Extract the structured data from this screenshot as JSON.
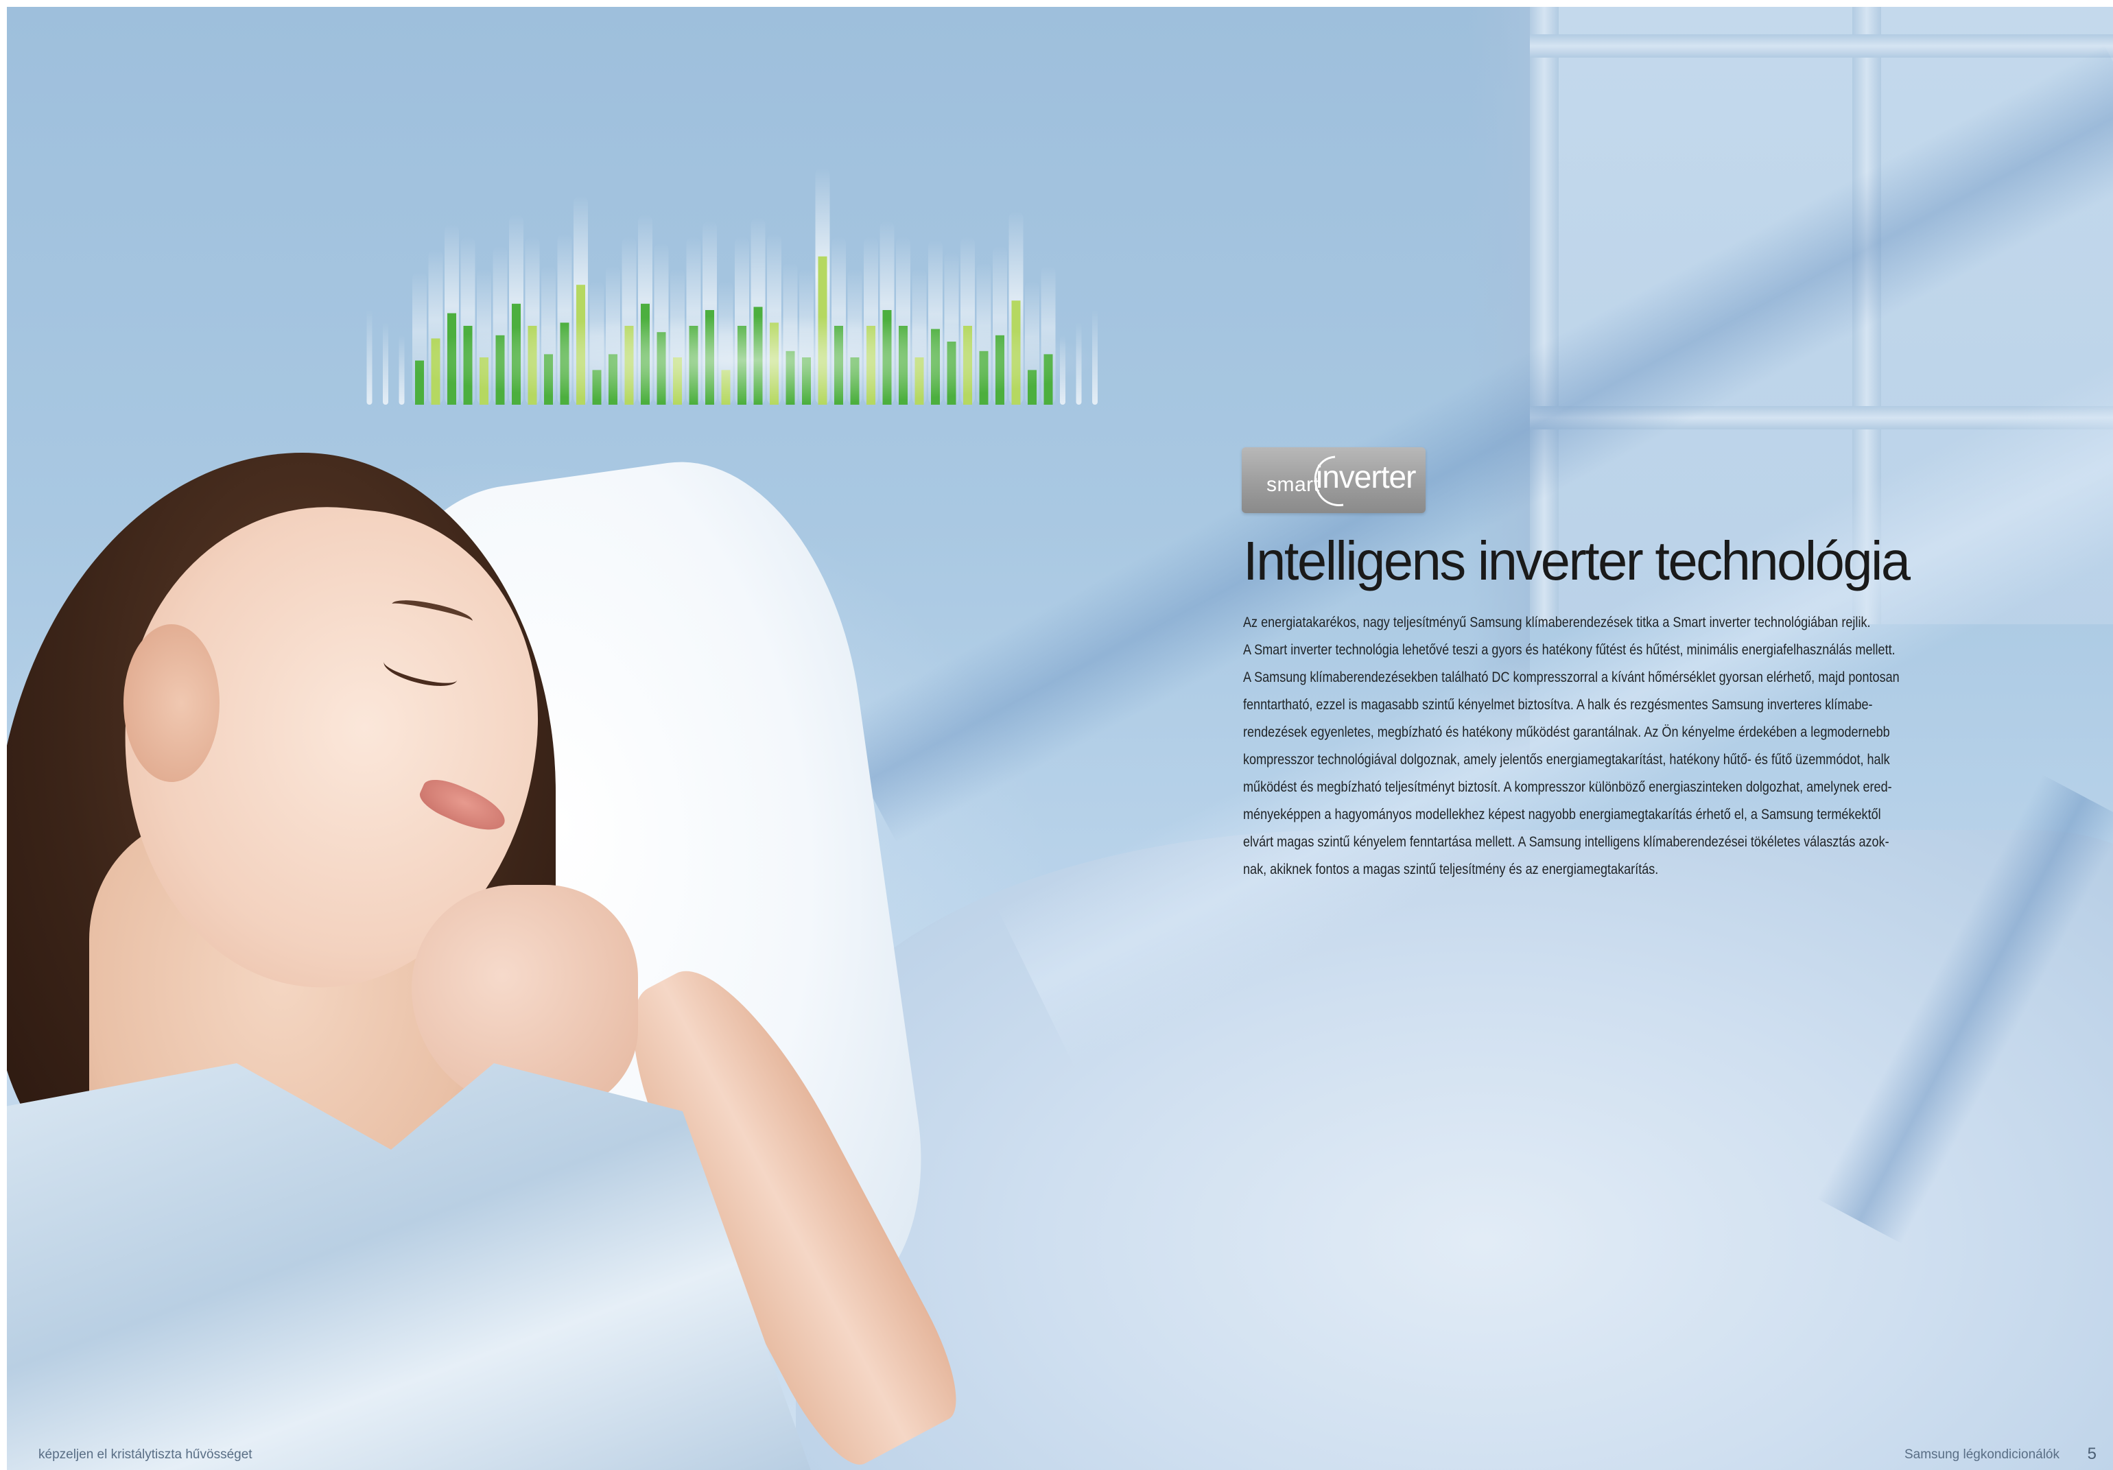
{
  "logo": {
    "word_small": "smart",
    "word_large": "inverter"
  },
  "headline": "Intelligens inverter technológia",
  "body_lines": [
    "Az energiatakarékos, nagy teljesítményű Samsung klímaberendezések titka a Smart inverter technológiában rejlik.",
    "A Smart inverter technológia lehetővé teszi a gyors és hatékony fűtést és hűtést, minimális energiafelhasználás mellett.",
    "A Samsung klímaberendezésekben található DC kompresszorral a kívánt hőmérséklet gyorsan elérhető, majd pontosan",
    "fenntartható, ezzel is magasabb szintű kényelmet biztosítva. A halk és rezgésmentes Samsung inverteres klímabe-",
    "rendezések egyenletes, megbízható és hatékony működést garantálnak. Az Ön kényelme érdekében a legmodernebb",
    "kompresszor technológiával dolgoznak, amely jelentős energiamegtakarítást, hatékony hűtő- és fűtő üzemmódot, halk",
    "működést és megbízható teljesítményt biztosít. A kompresszor különböző energiaszinteken dolgozhat, amelynek ered-",
    "ményeképpen a hagyományos modellekhez képest nagyobb energiamegtakarítás érhető el, a Samsung termékektől",
    "elvárt magas szintű kényelem fenntartása mellett. A Samsung intelligens klímaberendezései tökéletes választás azok-",
    "nak, akiknek fontos a magas szintű teljesítmény és az energiamegtakarítás."
  ],
  "footer": {
    "left": "képzeljen el kristálytiszta hűvösséget",
    "right": "Samsung légkondicionálók",
    "page_number": "5"
  },
  "equalizer": {
    "bar_levels": [
      0.28,
      0.42,
      0.58,
      0.5,
      0.3,
      0.44,
      0.64,
      0.5,
      0.32,
      0.52,
      0.76,
      0.22,
      0.32,
      0.5,
      0.64,
      0.46,
      0.3,
      0.5,
      0.6,
      0.22,
      0.5,
      0.62,
      0.52,
      0.34,
      0.3,
      0.94,
      0.5,
      0.3,
      0.5,
      0.6,
      0.5,
      0.3,
      0.48,
      0.4,
      0.5,
      0.34,
      0.44,
      0.66,
      0.22,
      0.32
    ],
    "colors": {
      "green_dark": "#4caf3e",
      "green_light": "#b5d861"
    }
  },
  "colors": {
    "background": "#a9c8e2",
    "headline": "#1a1a1a",
    "body": "#1f2326",
    "logo_badge": "#9d9d9d"
  }
}
